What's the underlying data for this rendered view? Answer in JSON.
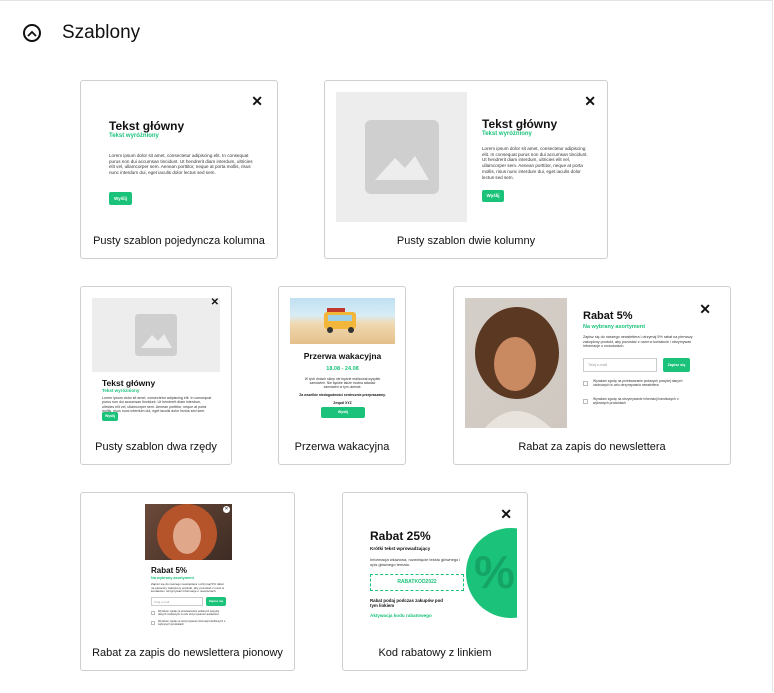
{
  "section": {
    "title": "Szablony"
  },
  "templates": [
    {
      "label": "Pusty szablon pojedyncza kolumna",
      "heading": "Tekst główny",
      "subheading": "Tekst wyróżniony",
      "body": "Lorem ipsum dolor sit amet, consectetur adipiscing elit. In consequat purus non dui accumsan tincidunt. Ut hendrerit diam interdum, ultricies elit vel, ullamcorper sem. Aenean porttitor, neque at porta mollis, risus nunc interdum dui, eget iaculis dolor lectus sed sem.",
      "button": "Wyślij"
    },
    {
      "label": "Pusty szablon dwie kolumny",
      "heading": "Tekst główny",
      "subheading": "Tekst wyróżniony",
      "body": "Lorem ipsum dolor sit amet, consectetur adipiscing elit. In consequat purus non dui accumsan tincidunt. Ut hendrerit diam interdum, ultricies elit vel, ullamcorper sem. Aenean porttitor, neque at porta mollis, risus nunc interdum dui, eget iaculis dolor lectus sed sem.",
      "button": "Wyślij"
    },
    {
      "label": "Pusty szablon dwa rzędy",
      "heading": "Tekst główny",
      "subheading": "Tekst wyróżniony",
      "body": "Lorem ipsum dolor sit amet, consectetur adipiscing elit. In consequat purus non dui accumsan tincidunt. Ut hendrerit diam interdum, ultricies elit vel, ullamcorper sem. Aenean porttitor, neque at porta mollis, risus nunc interdum dui, eget iaculis dolor lectus sed sem.",
      "button": "Wyślij"
    },
    {
      "label": "Przerwa wakacyjna",
      "heading": "Przerwa wakacyjna",
      "dates": "18.08 - 24.08",
      "body": "W tych dniach sklep nie będzie realizował wysyłek zamówień. Nie będzie także można składać zamówień w tym okresie.",
      "body2": "Za wszelkie niedogodności serdecznie przepraszamy.",
      "signature": "Zespół XYZ",
      "button": "Wyślij"
    },
    {
      "label": "Rabat za zapis do newslettera",
      "heading": "Rabat 5%",
      "subheading": "Na wybrany asortyment",
      "body": "Zapisz się do naszego newslettera i otrzymaj 5% rabat na pierwszy zakupiony produkt, aby pozostać z nami w kontakcie i otrzymywać informacje o nowościach.",
      "email_placeholder": "Twój e-mail",
      "button": "Zapisz się",
      "consent1": "Wyrażam zgodę na przetwarzanie podanych powyżej danych osobowych w celu otrzymywania newslettera",
      "consent2": "Wyrażam zgodę na otrzymywanie informacji handlowych o wybranych produktach"
    },
    {
      "label": "Rabat za zapis do newslettera pionowy",
      "heading": "Rabat 5%",
      "subheading": "Na wybrany asortyment",
      "body": "Zapisz się do naszego newslettera i otrzymaj 5% rabat na pierwszy zakupiony produkt, aby pozostać z nami w kontakcie i otrzymywać informacje o nowościach.",
      "email_placeholder": "Twój e-mail",
      "button": "Zapisz się",
      "consent1": "Wyrażam zgodę na przetwarzanie podanych powyżej danych osobowych w celu otrzymywania newslettera",
      "consent2": "Wyrażam zgodę na otrzymywanie informacji handlowych o wybranych produktach"
    },
    {
      "label": "Kod rabatowy z linkiem",
      "heading": "Rabat 25%",
      "subheading": "Krótki tekst wprowadzający",
      "body": "Informacja wkażowa, rozwinięcie tekstu głównego i opis głównego tematu.",
      "code": "RABATKOD2022",
      "note": "Rabat podaj podczas zakupów pod tym linkiem",
      "link": "Aktywacja kodu rabatowego",
      "badge": "%"
    }
  ],
  "close_glyph": "✕",
  "colors": {
    "accent": "#1bc27a",
    "border": "#cfcfcf",
    "placeholder": "#ededed"
  }
}
